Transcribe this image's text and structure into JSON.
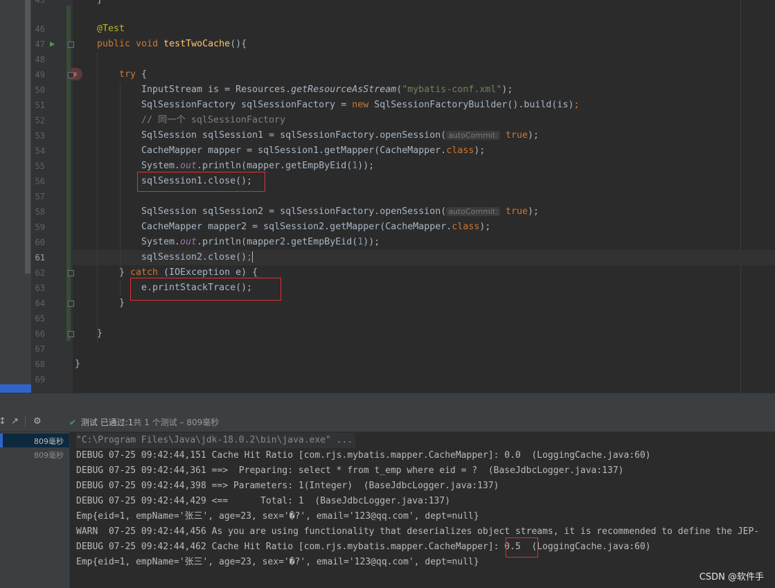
{
  "editor": {
    "line_numbers": [
      "45",
      "46",
      "47",
      "48",
      "49",
      "50",
      "51",
      "52",
      "53",
      "54",
      "55",
      "56",
      "57",
      "58",
      "59",
      "60",
      "61",
      "62",
      "63",
      "64",
      "65",
      "66",
      "67",
      "68",
      "69"
    ],
    "top_brace": "}",
    "annotation": "@Test",
    "kw_public": "public",
    "kw_void": "void",
    "method_name": "testTwoCache",
    "method_suffix": "(){",
    "kw_try": "try",
    "try_brace": " {",
    "l50_a": "InputStream is = Resources.",
    "l50_b": "getResourceAsStream",
    "l50_c": "(",
    "l50_str": "\"mybatis-conf.xml\"",
    "l50_d": ");",
    "l51_a": "SqlSessionFactory sqlSessionFactory = ",
    "kw_new": "new",
    "l51_b": " SqlSessionFactoryBuilder().build(is)",
    "semicolon": ";",
    "l52_comment": "// 同一个 sqlSessionFactory",
    "l53_a": "SqlSession sqlSession1 = sqlSessionFactory.openSession(",
    "hint_autocommit": "autoCommit:",
    "kw_true": "true",
    "close_paren_semi": ");",
    "l54_a": "CacheMapper mapper = sqlSession1.getMapper(CacheMapper.",
    "kw_class": "class",
    "l55_a": "System.",
    "l55_out": "out",
    "l55_b": ".println(mapper.getEmpByEid(",
    "num_1": "1",
    "l55_c": "));",
    "l56": "sqlSession1.close();",
    "l58_a": "SqlSession sqlSession2 = sqlSessionFactory.openSession(",
    "l59_a": "CacheMapper mapper2 = sqlSession2.getMapper(CacheMapper.",
    "l60_b": ".println(mapper2.getEmpByEid(",
    "l61_a": "sqlSession2.close()",
    "l62_a": "} ",
    "kw_catch": "catch",
    "l62_b": " (IOException e) {",
    "l63": "e.printStackTrace();",
    "brace_close": "}"
  },
  "test_toolbar": {
    "status_label": "测试",
    "status_passed": "已通过:",
    "passed_count": "1",
    "status_rest": "共 1 个测试 – 809毫秒"
  },
  "test_tree": {
    "items": [
      "809毫秒",
      "809毫秒"
    ]
  },
  "console": {
    "lines": [
      "\"C:\\Program Files\\Java\\jdk-18.0.2\\bin\\java.exe\" ...",
      "DEBUG 07-25 09:42:44,151 Cache Hit Ratio [com.rjs.mybatis.mapper.CacheMapper]: 0.0  (LoggingCache.java:60)",
      "DEBUG 07-25 09:42:44,361 ==>  Preparing: select * from t_emp where eid = ?  (BaseJdbcLogger.java:137)",
      "DEBUG 07-25 09:42:44,398 ==> Parameters: 1(Integer)  (BaseJdbcLogger.java:137)",
      "DEBUG 07-25 09:42:44,429 <==      Total: 1  (BaseJdbcLogger.java:137)",
      "Emp{eid=1, empName='张三', age=23, sex='�?', email='123@qq.com', dept=null}",
      "WARN  07-25 09:42:44,456 As you are using functionality that deserializes object streams, it is recommended to define the JEP-",
      "DEBUG 07-25 09:42:44,462 Cache Hit Ratio [com.rjs.mybatis.mapper.CacheMapper]: 0.5  (LoggingCache.java:60)",
      "Emp{eid=1, empName='张三', age=23, sex='�?', email='123@qq.com', dept=null}"
    ]
  },
  "watermark": "CSDN @软件手"
}
